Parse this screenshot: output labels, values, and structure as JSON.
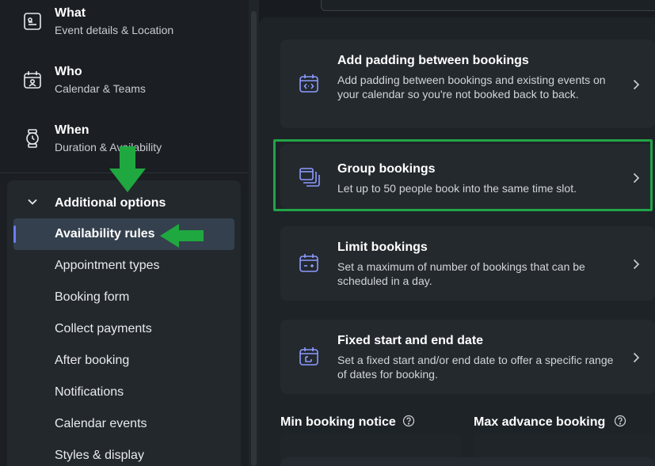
{
  "sidebar": {
    "nav": [
      {
        "title": "What",
        "subtitle": "Event details & Location",
        "icon": "event-details-icon"
      },
      {
        "title": "Who",
        "subtitle": "Calendar & Teams",
        "icon": "calendar-person-icon"
      },
      {
        "title": "When",
        "subtitle": "Duration & Availability",
        "icon": "watch-icon"
      }
    ],
    "options_title": "Additional options",
    "items": [
      {
        "label": "Availability rules",
        "active": true
      },
      {
        "label": "Appointment types"
      },
      {
        "label": "Booking form"
      },
      {
        "label": "Collect payments"
      },
      {
        "label": "After booking"
      },
      {
        "label": "Notifications"
      },
      {
        "label": "Calendar events"
      },
      {
        "label": "Styles & display"
      }
    ]
  },
  "main": {
    "cards": [
      {
        "title": "Add padding between bookings",
        "description": "Add padding between bookings and existing events on your calendar so you're not booked back to back.",
        "icon": "padding-calendar-icon"
      },
      {
        "title": "Group bookings",
        "description": "Let up to 50 people book into the same time slot.",
        "icon": "group-stack-icon"
      },
      {
        "title": "Limit bookings",
        "description": "Set a maximum of number of bookings that can be scheduled in a day.",
        "icon": "limit-calendar-icon"
      },
      {
        "title": "Fixed start and end date",
        "description": "Set a fixed start and/or end date to offer a specific range of dates for booking.",
        "icon": "fixed-date-calendar-icon"
      }
    ],
    "min_notice_label": "Min booking notice",
    "max_advance_label": "Max advance booking"
  },
  "colors": {
    "accent": "#8c9aff",
    "highlight": "#22a447",
    "arrow": "#1fa83f"
  }
}
